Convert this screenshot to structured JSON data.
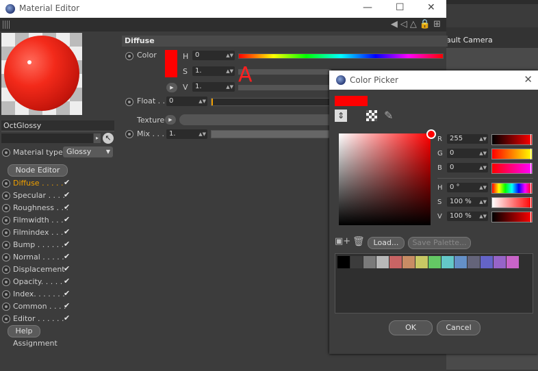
{
  "background": {
    "camera_label": "ault Camera"
  },
  "material_editor": {
    "title": "Material Editor",
    "material_name": "OctGlossy",
    "material_type_label": "Material type",
    "material_type_value": "Glossy",
    "node_editor_label": "Node Editor",
    "channels": [
      {
        "label": "Diffuse . . . . .",
        "active": true
      },
      {
        "label": "Specular . . . .",
        "active": false
      },
      {
        "label": "Roughness . . .",
        "active": false
      },
      {
        "label": "Filmwidth . . .",
        "active": false
      },
      {
        "label": "Filmindex . . .",
        "active": false
      },
      {
        "label": "Bump . . . . . .",
        "active": false
      },
      {
        "label": "Normal . . . . .",
        "active": false
      },
      {
        "label": "Displacement",
        "active": false
      },
      {
        "label": "Opacity. . . . .",
        "active": false
      },
      {
        "label": "Index. . . . . . .",
        "active": false
      },
      {
        "label": "Common . . . .",
        "active": false
      },
      {
        "label": "Editor . . . . . .",
        "active": false
      }
    ],
    "help_label": "Help",
    "assignment_label": "Assignment",
    "section_title": "Diffuse",
    "color_label": "Color",
    "h_label": "H",
    "h_value": "0",
    "s_label": "S",
    "s_value": "1.",
    "v_label": "V",
    "v_value": "1.",
    "annotation": "A",
    "float_label": "Float . .",
    "float_value": "0",
    "texture_label": "Texture",
    "mix_label": "Mix . . .",
    "mix_value": "1."
  },
  "color_picker": {
    "title": "Color Picker",
    "r_label": "R",
    "r_value": "255",
    "g_label": "G",
    "g_value": "0",
    "b_label": "B",
    "b_value": "0",
    "h_label": "H",
    "h_value": "0 °",
    "s_label": "S",
    "s_value": "100 %",
    "v_label": "V",
    "v_value": "100 %",
    "load_label": "Load...",
    "save_palette_label": "Save Palette...",
    "ok_label": "OK",
    "cancel_label": "Cancel",
    "palette_colors": [
      "#000000",
      "#3c3c3c",
      "#7a7a7a",
      "#b8b8b8",
      "#c86464",
      "#c88c64",
      "#c8c864",
      "#64c864",
      "#64c8c8",
      "#6490c8",
      "#64647a",
      "#6464c8",
      "#9664c8",
      "#c864c8"
    ],
    "current_color": "#ff0000"
  }
}
